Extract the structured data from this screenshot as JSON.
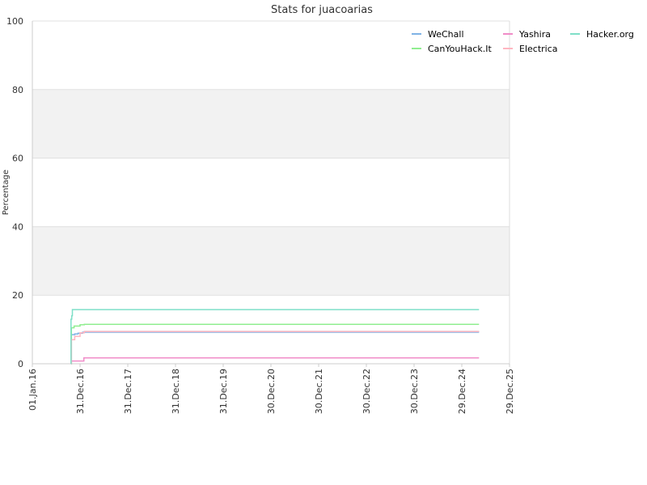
{
  "chart_data": {
    "type": "line",
    "title": "Stats for juacoarias",
    "xlabel": "",
    "ylabel": "Percentage",
    "ylim": [
      0,
      100
    ],
    "xlim": [
      "2016-01-01",
      "2025-12-29"
    ],
    "y_ticks": [
      "0",
      "20",
      "40",
      "60",
      "80",
      "100"
    ],
    "x_ticks": [
      {
        "date": "2016-01-01",
        "label": "01.Jan.16"
      },
      {
        "date": "2016-12-31",
        "label": "31.Dec.16"
      },
      {
        "date": "2017-12-31",
        "label": "31.Dec.17"
      },
      {
        "date": "2018-12-31",
        "label": "31.Dec.18"
      },
      {
        "date": "2019-12-31",
        "label": "31.Dec.19"
      },
      {
        "date": "2020-12-30",
        "label": "30.Dec.20"
      },
      {
        "date": "2021-12-30",
        "label": "30.Dec.21"
      },
      {
        "date": "2022-12-30",
        "label": "30.Dec.22"
      },
      {
        "date": "2023-12-30",
        "label": "30.Dec.23"
      },
      {
        "date": "2024-12-29",
        "label": "29.Dec.24"
      },
      {
        "date": "2025-12-29",
        "label": "29.Dec.25"
      }
    ],
    "grid": "horizontal alternating bands",
    "legend_position": "top-right",
    "series": [
      {
        "name": "WeChall",
        "color": "#7fb2e5",
        "points": [
          [
            "2016-10-25",
            0
          ],
          [
            "2016-10-26",
            8.5
          ],
          [
            "2016-11-20",
            8.7
          ],
          [
            "2016-12-15",
            8.9
          ],
          [
            "2017-01-20",
            9.2
          ],
          [
            "2025-05-10",
            9.2
          ]
        ]
      },
      {
        "name": "CanYouHack.It",
        "color": "#90ee90",
        "points": [
          [
            "2016-10-25",
            0
          ],
          [
            "2016-10-26",
            10.5
          ],
          [
            "2016-11-15",
            11.0
          ],
          [
            "2016-12-31",
            11.4
          ],
          [
            "2017-02-01",
            11.5
          ],
          [
            "2025-05-10",
            11.5
          ]
        ]
      },
      {
        "name": "Yashira",
        "color": "#f08cc8",
        "points": [
          [
            "2016-10-25",
            0
          ],
          [
            "2016-10-26",
            0.8
          ],
          [
            "2017-01-28",
            0.8
          ],
          [
            "2017-01-29",
            1.7
          ],
          [
            "2025-05-10",
            1.7
          ]
        ]
      },
      {
        "name": "Electrica",
        "color": "#ffb6c1",
        "points": [
          [
            "2016-10-25",
            0
          ],
          [
            "2016-10-26",
            7.0
          ],
          [
            "2016-11-20",
            8.0
          ],
          [
            "2016-12-31",
            9.0
          ],
          [
            "2017-02-01",
            9.4
          ],
          [
            "2025-05-10",
            9.4
          ]
        ]
      },
      {
        "name": "Hacker.org",
        "color": "#7fdfc8",
        "points": [
          [
            "2016-10-22",
            0
          ],
          [
            "2016-10-23",
            13.0
          ],
          [
            "2016-10-28",
            14.0
          ],
          [
            "2016-11-02",
            15.8
          ],
          [
            "2025-05-10",
            15.8
          ]
        ]
      }
    ],
    "extra_line": {
      "color": "#aaaaaa",
      "points": [
        [
          "2017-01-28",
          9.4
        ],
        [
          "2025-05-10",
          9.4
        ]
      ]
    }
  }
}
